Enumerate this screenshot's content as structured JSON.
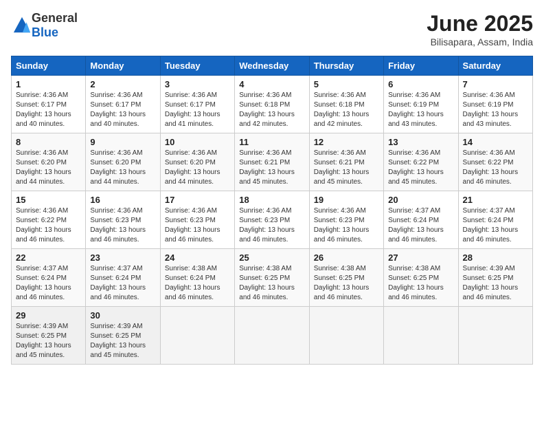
{
  "header": {
    "logo_general": "General",
    "logo_blue": "Blue",
    "month": "June 2025",
    "location": "Bilisapara, Assam, India"
  },
  "days_of_week": [
    "Sunday",
    "Monday",
    "Tuesday",
    "Wednesday",
    "Thursday",
    "Friday",
    "Saturday"
  ],
  "weeks": [
    [
      {
        "day": 1,
        "sunrise": "Sunrise: 4:36 AM",
        "sunset": "Sunset: 6:17 PM",
        "daylight": "Daylight: 13 hours and 40 minutes."
      },
      {
        "day": 2,
        "sunrise": "Sunrise: 4:36 AM",
        "sunset": "Sunset: 6:17 PM",
        "daylight": "Daylight: 13 hours and 40 minutes."
      },
      {
        "day": 3,
        "sunrise": "Sunrise: 4:36 AM",
        "sunset": "Sunset: 6:17 PM",
        "daylight": "Daylight: 13 hours and 41 minutes."
      },
      {
        "day": 4,
        "sunrise": "Sunrise: 4:36 AM",
        "sunset": "Sunset: 6:18 PM",
        "daylight": "Daylight: 13 hours and 42 minutes."
      },
      {
        "day": 5,
        "sunrise": "Sunrise: 4:36 AM",
        "sunset": "Sunset: 6:18 PM",
        "daylight": "Daylight: 13 hours and 42 minutes."
      },
      {
        "day": 6,
        "sunrise": "Sunrise: 4:36 AM",
        "sunset": "Sunset: 6:19 PM",
        "daylight": "Daylight: 13 hours and 43 minutes."
      },
      {
        "day": 7,
        "sunrise": "Sunrise: 4:36 AM",
        "sunset": "Sunset: 6:19 PM",
        "daylight": "Daylight: 13 hours and 43 minutes."
      }
    ],
    [
      {
        "day": 8,
        "sunrise": "Sunrise: 4:36 AM",
        "sunset": "Sunset: 6:20 PM",
        "daylight": "Daylight: 13 hours and 44 minutes."
      },
      {
        "day": 9,
        "sunrise": "Sunrise: 4:36 AM",
        "sunset": "Sunset: 6:20 PM",
        "daylight": "Daylight: 13 hours and 44 minutes."
      },
      {
        "day": 10,
        "sunrise": "Sunrise: 4:36 AM",
        "sunset": "Sunset: 6:20 PM",
        "daylight": "Daylight: 13 hours and 44 minutes."
      },
      {
        "day": 11,
        "sunrise": "Sunrise: 4:36 AM",
        "sunset": "Sunset: 6:21 PM",
        "daylight": "Daylight: 13 hours and 45 minutes."
      },
      {
        "day": 12,
        "sunrise": "Sunrise: 4:36 AM",
        "sunset": "Sunset: 6:21 PM",
        "daylight": "Daylight: 13 hours and 45 minutes."
      },
      {
        "day": 13,
        "sunrise": "Sunrise: 4:36 AM",
        "sunset": "Sunset: 6:22 PM",
        "daylight": "Daylight: 13 hours and 45 minutes."
      },
      {
        "day": 14,
        "sunrise": "Sunrise: 4:36 AM",
        "sunset": "Sunset: 6:22 PM",
        "daylight": "Daylight: 13 hours and 46 minutes."
      }
    ],
    [
      {
        "day": 15,
        "sunrise": "Sunrise: 4:36 AM",
        "sunset": "Sunset: 6:22 PM",
        "daylight": "Daylight: 13 hours and 46 minutes."
      },
      {
        "day": 16,
        "sunrise": "Sunrise: 4:36 AM",
        "sunset": "Sunset: 6:23 PM",
        "daylight": "Daylight: 13 hours and 46 minutes."
      },
      {
        "day": 17,
        "sunrise": "Sunrise: 4:36 AM",
        "sunset": "Sunset: 6:23 PM",
        "daylight": "Daylight: 13 hours and 46 minutes."
      },
      {
        "day": 18,
        "sunrise": "Sunrise: 4:36 AM",
        "sunset": "Sunset: 6:23 PM",
        "daylight": "Daylight: 13 hours and 46 minutes."
      },
      {
        "day": 19,
        "sunrise": "Sunrise: 4:36 AM",
        "sunset": "Sunset: 6:23 PM",
        "daylight": "Daylight: 13 hours and 46 minutes."
      },
      {
        "day": 20,
        "sunrise": "Sunrise: 4:37 AM",
        "sunset": "Sunset: 6:24 PM",
        "daylight": "Daylight: 13 hours and 46 minutes."
      },
      {
        "day": 21,
        "sunrise": "Sunrise: 4:37 AM",
        "sunset": "Sunset: 6:24 PM",
        "daylight": "Daylight: 13 hours and 46 minutes."
      }
    ],
    [
      {
        "day": 22,
        "sunrise": "Sunrise: 4:37 AM",
        "sunset": "Sunset: 6:24 PM",
        "daylight": "Daylight: 13 hours and 46 minutes."
      },
      {
        "day": 23,
        "sunrise": "Sunrise: 4:37 AM",
        "sunset": "Sunset: 6:24 PM",
        "daylight": "Daylight: 13 hours and 46 minutes."
      },
      {
        "day": 24,
        "sunrise": "Sunrise: 4:38 AM",
        "sunset": "Sunset: 6:24 PM",
        "daylight": "Daylight: 13 hours and 46 minutes."
      },
      {
        "day": 25,
        "sunrise": "Sunrise: 4:38 AM",
        "sunset": "Sunset: 6:25 PM",
        "daylight": "Daylight: 13 hours and 46 minutes."
      },
      {
        "day": 26,
        "sunrise": "Sunrise: 4:38 AM",
        "sunset": "Sunset: 6:25 PM",
        "daylight": "Daylight: 13 hours and 46 minutes."
      },
      {
        "day": 27,
        "sunrise": "Sunrise: 4:38 AM",
        "sunset": "Sunset: 6:25 PM",
        "daylight": "Daylight: 13 hours and 46 minutes."
      },
      {
        "day": 28,
        "sunrise": "Sunrise: 4:39 AM",
        "sunset": "Sunset: 6:25 PM",
        "daylight": "Daylight: 13 hours and 46 minutes."
      }
    ],
    [
      {
        "day": 29,
        "sunrise": "Sunrise: 4:39 AM",
        "sunset": "Sunset: 6:25 PM",
        "daylight": "Daylight: 13 hours and 45 minutes."
      },
      {
        "day": 30,
        "sunrise": "Sunrise: 4:39 AM",
        "sunset": "Sunset: 6:25 PM",
        "daylight": "Daylight: 13 hours and 45 minutes."
      },
      null,
      null,
      null,
      null,
      null
    ]
  ]
}
